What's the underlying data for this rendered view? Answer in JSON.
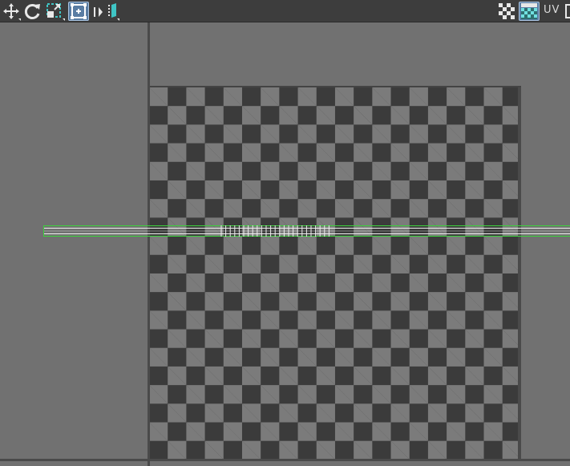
{
  "toolbar": {
    "left_tools": [
      {
        "name": "move-tool",
        "icon": "move-arrows-icon"
      },
      {
        "name": "rotate-tool",
        "icon": "rotate-icon"
      },
      {
        "name": "scale-tool",
        "icon": "scale-icon"
      },
      {
        "name": "box-select-tool",
        "icon": "box-select-icon",
        "active": true
      },
      {
        "name": "stitch-tool",
        "icon": "stitch-icon"
      },
      {
        "name": "align-tool",
        "icon": "align-icon"
      }
    ],
    "right_tools": [
      {
        "name": "checker-toggle",
        "icon": "checker-icon"
      },
      {
        "name": "texture-display-toggle",
        "icon": "texture-display-icon",
        "active": true
      }
    ],
    "uv_label": "UV"
  },
  "colors": {
    "toolbar_bg": "#3d3d3d",
    "viewport_bg": "#717171",
    "checker_dark": "#3b3b3b",
    "checker_light": "#7b7b7b",
    "uv_outline": "#3cd23c",
    "uv_edge": "#f0f0f0",
    "active_tool": "#5a7da3"
  }
}
